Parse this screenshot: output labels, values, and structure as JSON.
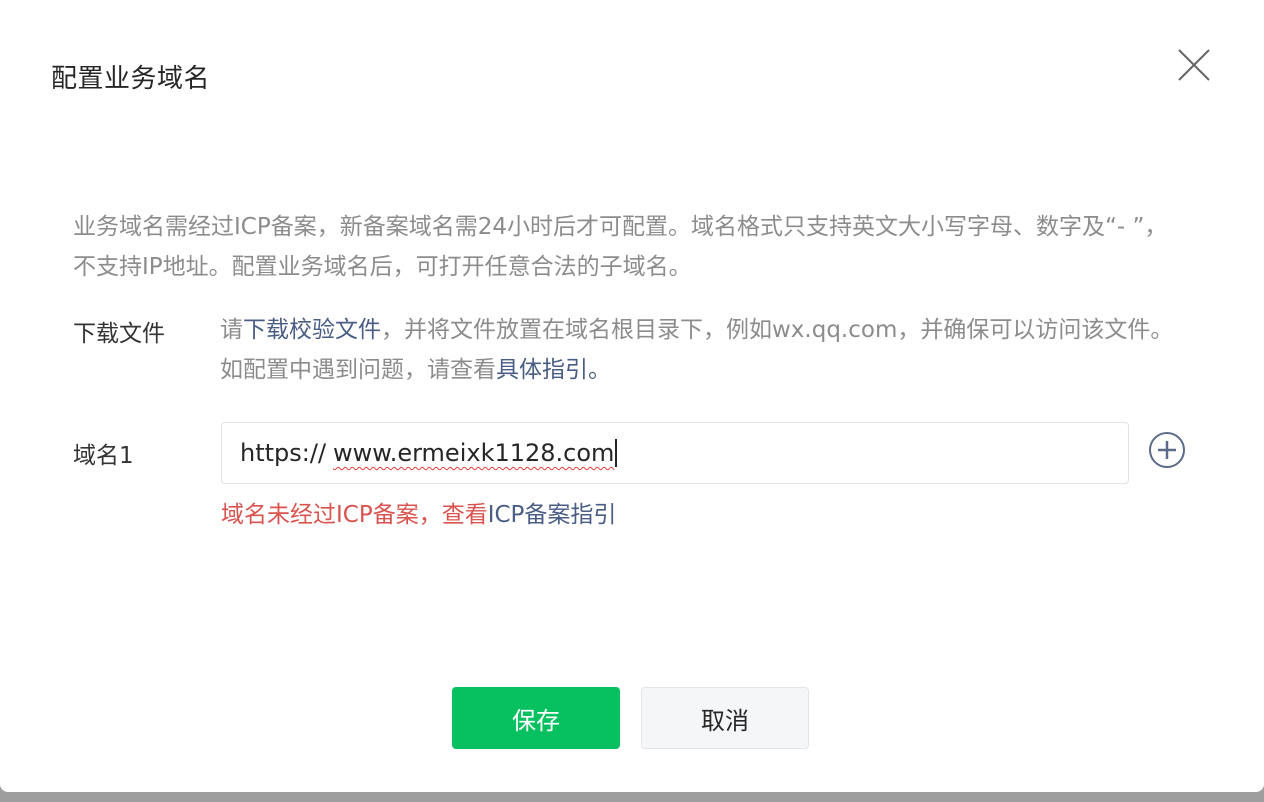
{
  "dialog": {
    "title": "配置业务域名",
    "description": "业务域名需经过ICP备案，新备案域名需24小时后才可配置。域名格式只支持英文大小写字母、数字及“- ”，不支持IP地址。配置业务域名后，可打开任意合法的子域名。"
  },
  "download": {
    "label": "下载文件",
    "text_prefix": "请",
    "link_file": "下载校验文件",
    "text_middle": "，并将文件放置在域名根目录下，例如wx.qq.com，并确保可以访问该文件。如配置中遇到问题，请查看",
    "link_guide": "具体指引。"
  },
  "domain": {
    "label": "域名1",
    "prefix": "https://",
    "value": "www.ermeixk1128.com",
    "error_text": "域名未经过ICP备案，查看",
    "error_link": "ICP备案指引"
  },
  "buttons": {
    "save": "保存",
    "cancel": "取消"
  },
  "icons": {
    "close": "close-icon",
    "add": "plus-circle-icon"
  },
  "colors": {
    "primary": "#07c160",
    "link": "#4a5d85",
    "error": "#d9534f"
  }
}
